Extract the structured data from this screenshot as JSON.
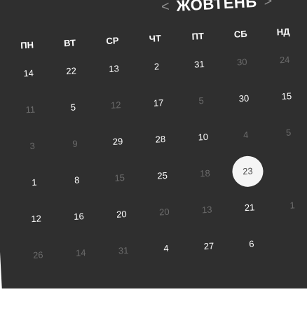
{
  "header": {
    "prev_glyph": "<",
    "month": "ЖОВТЕНЬ",
    "next_glyph": ">"
  },
  "weekdays": [
    "ПН",
    "ВТ",
    "СР",
    "ЧТ",
    "ПТ",
    "СБ",
    "НД"
  ],
  "days": [
    {
      "row": 0,
      "col": 0,
      "text": "14",
      "state": "cur"
    },
    {
      "row": 0,
      "col": 1,
      "text": "22",
      "state": "cur"
    },
    {
      "row": 0,
      "col": 2,
      "text": "13",
      "state": "cur"
    },
    {
      "row": 0,
      "col": 3,
      "text": "2",
      "state": "cur"
    },
    {
      "row": 0,
      "col": 4,
      "text": "31",
      "state": "cur"
    },
    {
      "row": 0,
      "col": 5,
      "text": "30",
      "state": "dim"
    },
    {
      "row": 0,
      "col": 6,
      "text": "24",
      "state": "dim"
    },
    {
      "row": 1,
      "col": 0,
      "text": "11",
      "state": "dim"
    },
    {
      "row": 1,
      "col": 1,
      "text": "5",
      "state": "cur"
    },
    {
      "row": 1,
      "col": 2,
      "text": "12",
      "state": "dim"
    },
    {
      "row": 1,
      "col": 3,
      "text": "17",
      "state": "cur"
    },
    {
      "row": 1,
      "col": 4,
      "text": "5",
      "state": "dim"
    },
    {
      "row": 1,
      "col": 5,
      "text": "30",
      "state": "cur"
    },
    {
      "row": 1,
      "col": 6,
      "text": "15",
      "state": "cur"
    },
    {
      "row": 2,
      "col": 0,
      "text": "3",
      "state": "dim"
    },
    {
      "row": 2,
      "col": 1,
      "text": "9",
      "state": "dim"
    },
    {
      "row": 2,
      "col": 2,
      "text": "29",
      "state": "cur"
    },
    {
      "row": 2,
      "col": 3,
      "text": "28",
      "state": "cur"
    },
    {
      "row": 2,
      "col": 4,
      "text": "10",
      "state": "cur"
    },
    {
      "row": 2,
      "col": 5,
      "text": "4",
      "state": "dim"
    },
    {
      "row": 2,
      "col": 6,
      "text": "5",
      "state": "dim"
    },
    {
      "row": 3,
      "col": 0,
      "text": "1",
      "state": "cur"
    },
    {
      "row": 3,
      "col": 1,
      "text": "8",
      "state": "cur"
    },
    {
      "row": 3,
      "col": 2,
      "text": "15",
      "state": "dim"
    },
    {
      "row": 3,
      "col": 3,
      "text": "25",
      "state": "cur"
    },
    {
      "row": 3,
      "col": 4,
      "text": "18",
      "state": "dim"
    },
    {
      "row": 3,
      "col": 5,
      "text": "23",
      "state": "sel"
    },
    {
      "row": 4,
      "col": 0,
      "text": "12",
      "state": "cur"
    },
    {
      "row": 4,
      "col": 1,
      "text": "16",
      "state": "cur"
    },
    {
      "row": 4,
      "col": 2,
      "text": "20",
      "state": "cur"
    },
    {
      "row": 4,
      "col": 3,
      "text": "20",
      "state": "dim"
    },
    {
      "row": 4,
      "col": 4,
      "text": "13",
      "state": "dim"
    },
    {
      "row": 4,
      "col": 5,
      "text": "21",
      "state": "cur"
    },
    {
      "row": 4,
      "col": 6,
      "text": "1",
      "state": "dim"
    },
    {
      "row": 5,
      "col": 0,
      "text": "26",
      "state": "dim"
    },
    {
      "row": 5,
      "col": 1,
      "text": "14",
      "state": "dim"
    },
    {
      "row": 5,
      "col": 2,
      "text": "31",
      "state": "dim"
    },
    {
      "row": 5,
      "col": 3,
      "text": "4",
      "state": "cur"
    },
    {
      "row": 5,
      "col": 4,
      "text": "27",
      "state": "cur"
    },
    {
      "row": 5,
      "col": 5,
      "text": "6",
      "state": "cur"
    }
  ],
  "colors": {
    "panel": "#2f2f2f",
    "text": "#ffffff",
    "dim_text": "#6b6b6b",
    "selected_bg": "#f5f5f5"
  }
}
